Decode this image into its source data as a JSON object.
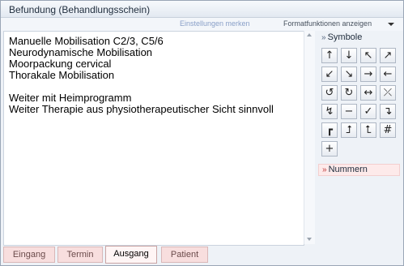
{
  "window": {
    "title": "Befundung (Behandlungsschein)"
  },
  "toolbar": {
    "settings_label": "Einstellungen merken",
    "format_label": "Formatfunktionen anzeigen"
  },
  "editor": {
    "text": "Manuelle Mobilisation C2/3, C5/6\nNeurodynamische Mobilisation\nMoorpackung cervical\nThorakale Mobilisation\n\nWeiter mit Heimprogramm\nWeiter Therapie aus physiotherapeutischer Sicht sinnvoll"
  },
  "side": {
    "symbols_label": "Symbole",
    "numbers_label": "Nummern",
    "symbols": [
      {
        "glyph": "↑",
        "icon": "arrow-up-icon"
      },
      {
        "glyph": "↓",
        "icon": "arrow-down-icon"
      },
      {
        "glyph": "↖",
        "icon": "arrow-up-left-icon"
      },
      {
        "glyph": "↗",
        "icon": "arrow-up-right-icon"
      },
      {
        "glyph": "↙",
        "icon": "arrow-down-left-icon"
      },
      {
        "glyph": "↘",
        "icon": "arrow-down-right-icon"
      },
      {
        "glyph": "→",
        "icon": "arrow-right-icon"
      },
      {
        "glyph": "←",
        "icon": "arrow-left-icon"
      },
      {
        "glyph": "↺",
        "icon": "rotate-left-icon"
      },
      {
        "glyph": "↻",
        "icon": "rotate-right-icon"
      },
      {
        "glyph": "↔",
        "icon": "arrow-left-right-icon"
      },
      {
        "glyph": "⤫",
        "icon": "cross-arrows-icon"
      },
      {
        "glyph": "↯",
        "icon": "lightning-arrow-icon"
      },
      {
        "glyph": "−",
        "icon": "minus-icon"
      },
      {
        "glyph": "✓",
        "icon": "check-icon"
      },
      {
        "glyph": "↴",
        "icon": "arrow-turn-down-icon"
      },
      {
        "glyph": "┏",
        "icon": "corner-icon"
      },
      {
        "glyph": "⮥",
        "icon": "arrow-turn-up-right-icon"
      },
      {
        "glyph": "⮤",
        "icon": "arrow-turn-up-left-icon"
      },
      {
        "glyph": "#",
        "icon": "hash-icon"
      },
      {
        "glyph": "+",
        "icon": "plus-icon"
      }
    ]
  },
  "tabs": [
    {
      "label": "Eingang",
      "active": false
    },
    {
      "label": "Termin",
      "active": false
    },
    {
      "label": "Ausgang",
      "active": true
    },
    {
      "label": "Patient",
      "active": false
    }
  ]
}
